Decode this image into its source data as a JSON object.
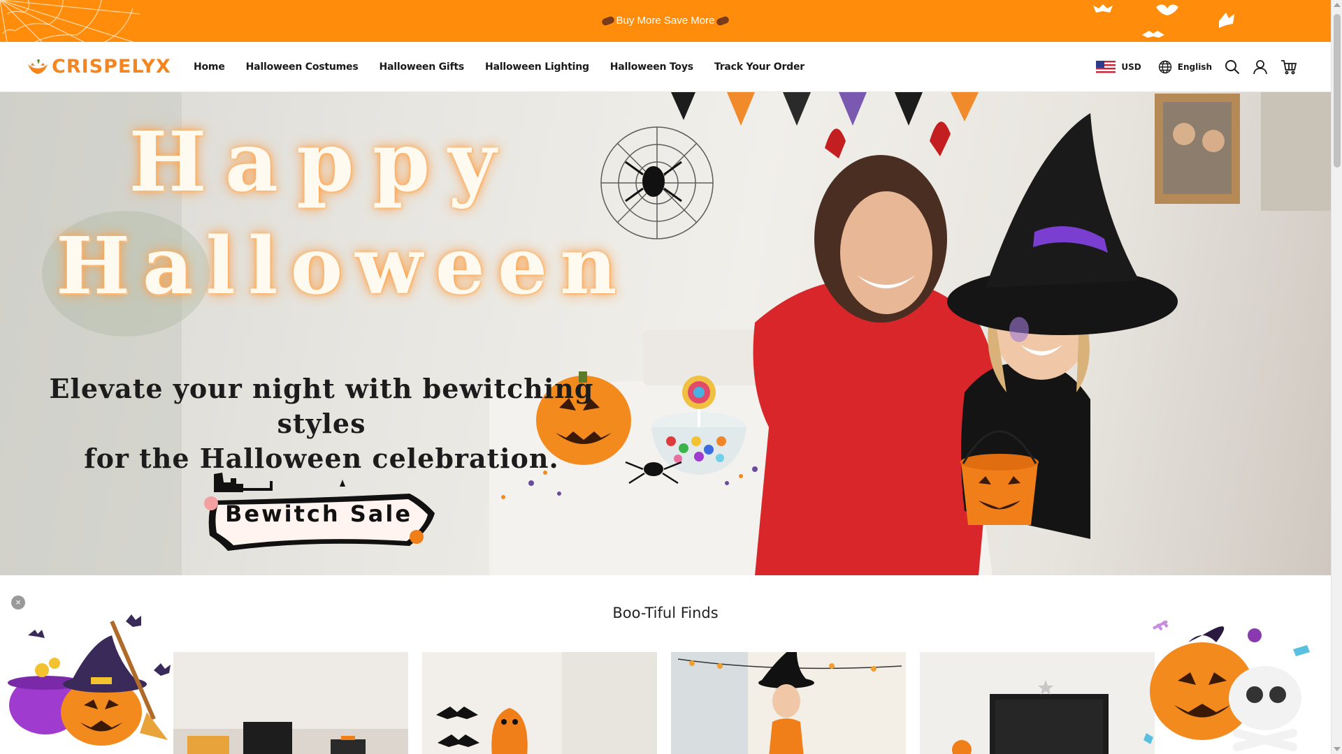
{
  "announcement": {
    "text": "Buy More Save More"
  },
  "brand": {
    "name": "CRISPELYX",
    "color": "#f5851f"
  },
  "nav": {
    "items": [
      {
        "label": "Home"
      },
      {
        "label": "Halloween Costumes"
      },
      {
        "label": "Halloween Gifts"
      },
      {
        "label": "Halloween Lighting"
      },
      {
        "label": "Halloween Toys"
      },
      {
        "label": "Track Your Order"
      }
    ]
  },
  "tools": {
    "currency": "USD",
    "currency_flag": "us-flag-icon",
    "language": "English",
    "icons": [
      "globe-icon",
      "search-icon",
      "user-icon",
      "cart-icon"
    ]
  },
  "hero": {
    "title_line1": "Happy",
    "title_line2": "Halloween",
    "subtitle_line1": "Elevate your night with bewitching styles",
    "subtitle_line2": "for the Halloween celebration.",
    "cta_label": "Bewitch Sale"
  },
  "section": {
    "title": "Boo-Tiful Finds"
  },
  "colors": {
    "announcement_bg": "#ff8c0a",
    "accent": "#f5851f"
  }
}
